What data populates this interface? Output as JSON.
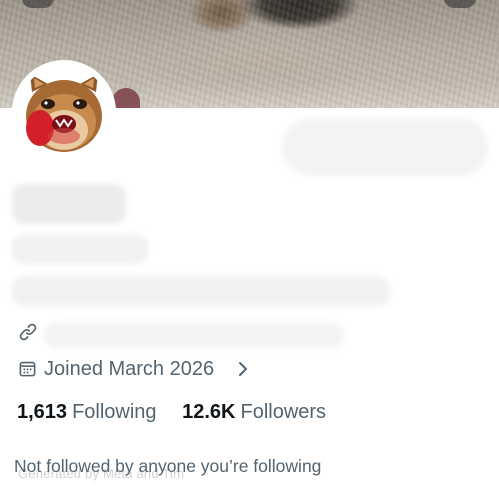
{
  "profile": {
    "joined_text": "Joined March 2026",
    "stats": {
      "following_count": "1,613",
      "following_label": "Following",
      "followers_count": "12.6K",
      "followers_label": "Followers"
    },
    "not_followed_text": "Not followed by anyone you’re following",
    "watermark_text": "Generated by Meta and Tim"
  },
  "icons": {
    "link": "link-icon",
    "calendar": "calendar-icon",
    "chevron": "chevron-right-icon"
  },
  "colors": {
    "primary_text": "#0f1419",
    "secondary_text": "#536471",
    "background": "#ffffff"
  }
}
